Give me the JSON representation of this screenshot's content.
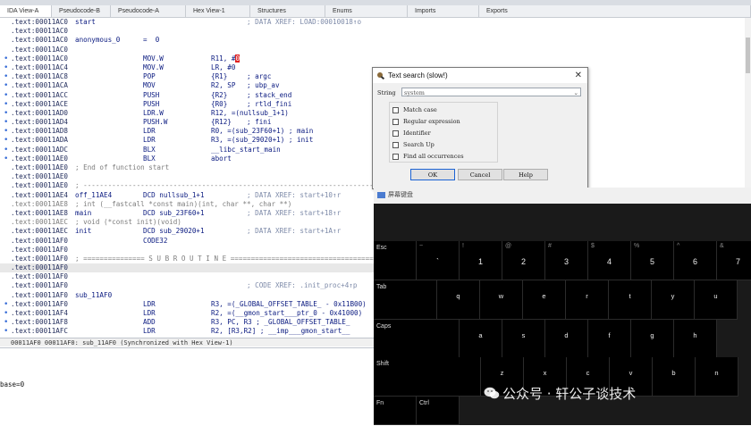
{
  "tabs": [
    "IDA View-A",
    "Pseudocode-B",
    "Pseudocode-A",
    "Hex View-1",
    "Structures",
    "Enums",
    "Imports",
    "Exports"
  ],
  "code_lines": [
    {
      "addr": ".text:00011AC0",
      "label": "start",
      "mn": "",
      "op": "",
      "cm": "",
      "xref": "; DATA XREF: LOAD:00010018↑o",
      "grey": false
    },
    {
      "addr": ".text:00011AC0",
      "label": "",
      "mn": "",
      "op": "",
      "cm": "",
      "xref": "",
      "grey": false
    },
    {
      "addr": ".text:00011AC0",
      "label": "anonymous_0",
      "mn": "=  0",
      "op": "",
      "cm": "",
      "xref": "",
      "grey": false
    },
    {
      "addr": ".text:00011AC0",
      "label": "",
      "mn": "",
      "op": "",
      "cm": "",
      "xref": "",
      "grey": false
    },
    {
      "addr": ".text:00011AC0",
      "label": "",
      "mn": "MOV.W",
      "op": "R11, #0",
      "cm": "",
      "xref": "",
      "grey": false,
      "dot": true,
      "redmark": true
    },
    {
      "addr": ".text:00011AC4",
      "label": "",
      "mn": "MOV.W",
      "op": "LR, #0",
      "cm": "",
      "xref": "",
      "grey": false,
      "dot": true
    },
    {
      "addr": ".text:00011AC8",
      "label": "",
      "mn": "POP",
      "op": "{R1}",
      "cm": "; argc",
      "xref": "",
      "grey": false,
      "dot": true
    },
    {
      "addr": ".text:00011ACA",
      "label": "",
      "mn": "MOV",
      "op": "R2, SP",
      "cm": "; ubp_av",
      "xref": "",
      "grey": false,
      "dot": true
    },
    {
      "addr": ".text:00011ACC",
      "label": "",
      "mn": "PUSH",
      "op": "{R2}",
      "cm": "; stack_end",
      "xref": "",
      "grey": false,
      "dot": true
    },
    {
      "addr": ".text:00011ACE",
      "label": "",
      "mn": "PUSH",
      "op": "{R0}",
      "cm": "; rtld_fini",
      "xref": "",
      "grey": false,
      "dot": true
    },
    {
      "addr": ".text:00011AD0",
      "label": "",
      "mn": "LDR.W",
      "op": "R12, =(nullsub_1+1)",
      "cm": "",
      "xref": "",
      "grey": false,
      "dot": true
    },
    {
      "addr": ".text:00011AD4",
      "label": "",
      "mn": "PUSH.W",
      "op": "{R12}",
      "cm": "; fini",
      "xref": "",
      "grey": false,
      "dot": true
    },
    {
      "addr": ".text:00011AD8",
      "label": "",
      "mn": "LDR",
      "op": "R0, =(sub_23F60+1) ; main",
      "cm": "",
      "xref": "",
      "grey": false,
      "dot": true
    },
    {
      "addr": ".text:00011ADA",
      "label": "",
      "mn": "LDR",
      "op": "R3, =(sub_29020+1) ; init",
      "cm": "",
      "xref": "",
      "grey": false,
      "dot": true
    },
    {
      "addr": ".text:00011ADC",
      "label": "",
      "mn": "BLX",
      "op": "__libc_start_main",
      "cm": "",
      "xref": "",
      "grey": false,
      "dot": true
    },
    {
      "addr": ".text:00011AE0",
      "label": "",
      "mn": "BLX",
      "op": "abort",
      "cm": "",
      "xref": "",
      "grey": false,
      "dot": true
    },
    {
      "addr": ".text:00011AE0",
      "label": "; End of function start",
      "mn": "",
      "op": "",
      "cm": "",
      "xref": "",
      "grey": false,
      "sep": true
    },
    {
      "addr": ".text:00011AE0",
      "label": "",
      "mn": "",
      "op": "",
      "cm": "",
      "xref": "",
      "grey": false
    },
    {
      "addr": ".text:00011AE0",
      "label": "; ---------------------------------------------------------------------------",
      "mn": "",
      "op": "",
      "cm": "",
      "xref": "",
      "grey": false,
      "sep": true
    },
    {
      "addr": ".text:00011AE4",
      "label": "off_11AE4",
      "mn": "DCD nullsub_1+1",
      "op": "",
      "cm": "",
      "xref": "; DATA XREF: start+10↑r",
      "grey": false
    },
    {
      "addr": ".text:00011AE8",
      "label": "; int (__fastcall *const main)(int, char **, char **)",
      "mn": "",
      "op": "",
      "cm": "",
      "xref": "",
      "grey": true,
      "sep": true
    },
    {
      "addr": ".text:00011AE8",
      "label": "main",
      "mn": "DCD sub_23F60+1",
      "op": "",
      "cm": "",
      "xref": "; DATA XREF: start+18↑r",
      "grey": false
    },
    {
      "addr": ".text:00011AEC",
      "label": "; void (*const init)(void)",
      "mn": "",
      "op": "",
      "cm": "",
      "xref": "",
      "grey": true,
      "sep": true
    },
    {
      "addr": ".text:00011AEC",
      "label": "init",
      "mn": "DCD sub_29020+1",
      "op": "",
      "cm": "",
      "xref": "; DATA XREF: start+1A↑r",
      "grey": false
    },
    {
      "addr": ".text:00011AF0",
      "label": "",
      "mn": "CODE32",
      "op": "",
      "cm": "",
      "xref": "",
      "grey": false
    },
    {
      "addr": ".text:00011AF0",
      "label": "",
      "mn": "",
      "op": "",
      "cm": "",
      "xref": "",
      "grey": false
    },
    {
      "addr": ".text:00011AF0",
      "label": "; =============== S U B R O U T I N E =======================================",
      "mn": "",
      "op": "",
      "cm": "",
      "xref": "",
      "grey": false,
      "sep": true
    },
    {
      "addr": ".text:00011AF0",
      "label": "",
      "mn": "",
      "op": "",
      "cm": "",
      "xref": "",
      "grey": false,
      "hl": true
    },
    {
      "addr": ".text:00011AF0",
      "label": "",
      "mn": "",
      "op": "",
      "cm": "",
      "xref": "",
      "grey": false
    },
    {
      "addr": ".text:00011AF0",
      "label": "",
      "mn": "",
      "op": "",
      "cm": "",
      "xref": "; CODE XREF: .init_proc+4↑p",
      "grey": false
    },
    {
      "addr": ".text:00011AF0",
      "label": "sub_11AF0",
      "mn": "",
      "op": "",
      "cm": "",
      "xref": "",
      "grey": false
    },
    {
      "addr": ".text:00011AF0",
      "label": "",
      "mn": "LDR",
      "op": "R3, =(_GLOBAL_OFFSET_TABLE_ - 0x11B00)",
      "cm": "",
      "xref": "",
      "grey": false,
      "dot": true
    },
    {
      "addr": ".text:00011AF4",
      "label": "",
      "mn": "LDR",
      "op": "R2, =(__gmon_start___ptr_0 - 0x41000)",
      "cm": "",
      "xref": "",
      "grey": false,
      "dot": true
    },
    {
      "addr": ".text:00011AF8",
      "label": "",
      "mn": "ADD",
      "op": "R3, PC, R3 ; _GLOBAL_OFFSET_TABLE_",
      "cm": "",
      "xref": "",
      "grey": false,
      "dot": true
    },
    {
      "addr": ".text:00011AFC",
      "label": "",
      "mn": "LDR",
      "op": "R2, [R3,R2] ; __imp___gmon_start__",
      "cm": "",
      "xref": "",
      "grey": false,
      "dot": true
    },
    {
      "addr": ".text:00011B00",
      "label": "",
      "mn": "CMP",
      "op": "R2, #0",
      "cm": "",
      "xref": "",
      "grey": false,
      "dot": true
    }
  ],
  "status_text": "00011AF0 00011AF0: sub_11AF0 (Synchronized with Hex View-1)",
  "output_text": "base=0",
  "dialog": {
    "title": "Text search (slow!)",
    "close": "✕",
    "string_label": "String",
    "string_value": "system",
    "options": [
      "Match case",
      "Regular expression",
      "Identifier",
      "Search Up",
      "Find all occurrences"
    ],
    "buttons": {
      "ok": "OK",
      "cancel": "Cancel",
      "help": "Help"
    }
  },
  "keyboard": {
    "title": "屏幕键盘",
    "row1": [
      {
        "main": "Esc",
        "shift": ""
      },
      {
        "main": "`",
        "shift": "~"
      },
      {
        "main": "1",
        "shift": "!"
      },
      {
        "main": "2",
        "shift": "@"
      },
      {
        "main": "3",
        "shift": "#"
      },
      {
        "main": "4",
        "shift": "$"
      },
      {
        "main": "5",
        "shift": "%"
      },
      {
        "main": "6",
        "shift": "^"
      },
      {
        "main": "7",
        "shift": "&"
      }
    ],
    "row2": [
      "Tab",
      "q",
      "w",
      "e",
      "r",
      "t",
      "y",
      "u"
    ],
    "row3": [
      "Caps",
      "a",
      "s",
      "d",
      "f",
      "g",
      "h"
    ],
    "row4": [
      "Shift",
      "z",
      "x",
      "c",
      "v",
      "b",
      "n"
    ],
    "row5": [
      "Fn",
      "Ctrl"
    ]
  },
  "watermark": "公众号 · 轩公子谈技术"
}
